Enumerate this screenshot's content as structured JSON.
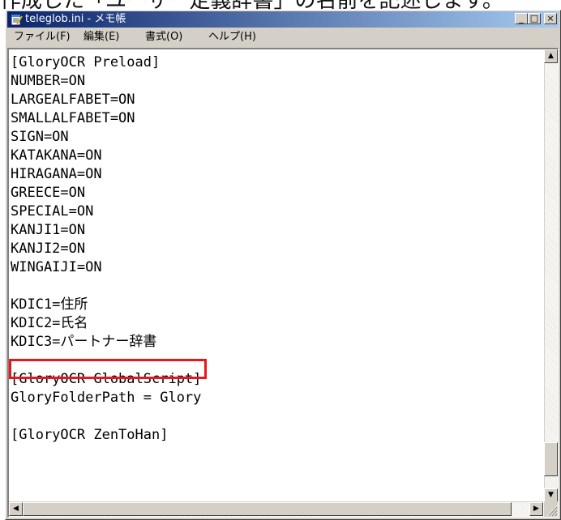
{
  "caption": "作成した「ユーザー定義辞書」の名前を記述します。",
  "window": {
    "title": "teleglob.ini - メモ帳",
    "buttons": {
      "minimize": "_",
      "maximize": "□",
      "close": "×"
    }
  },
  "menu": [
    {
      "label": "ファイル(F)"
    },
    {
      "label": "編集(E)"
    },
    {
      "label": "書式(O)"
    },
    {
      "label": "ヘルプ(H)"
    }
  ],
  "editor": {
    "lines": [
      "[GloryOCR Preload]",
      "NUMBER=ON",
      "LARGEALFABET=ON",
      "SMALLALFABET=ON",
      "SIGN=ON",
      "KATAKANA=ON",
      "HIRAGANA=ON",
      "GREECE=ON",
      "SPECIAL=ON",
      "KANJI1=ON",
      "KANJI2=ON",
      "WINGAIJI=ON",
      "",
      "KDIC1=住所",
      "KDIC2=氏名",
      "KDIC3=パートナー辞書",
      "",
      "[GloryOCR GlobalScript]",
      "GloryFolderPath = Glory",
      "",
      "[GloryOCR ZenToHan]"
    ],
    "highlighted_line": "KDIC3=パートナー辞書",
    "highlight_color": "#e81818"
  },
  "scroll": {
    "up": "▲",
    "down": "▼",
    "left": "◀",
    "right": "▶"
  }
}
